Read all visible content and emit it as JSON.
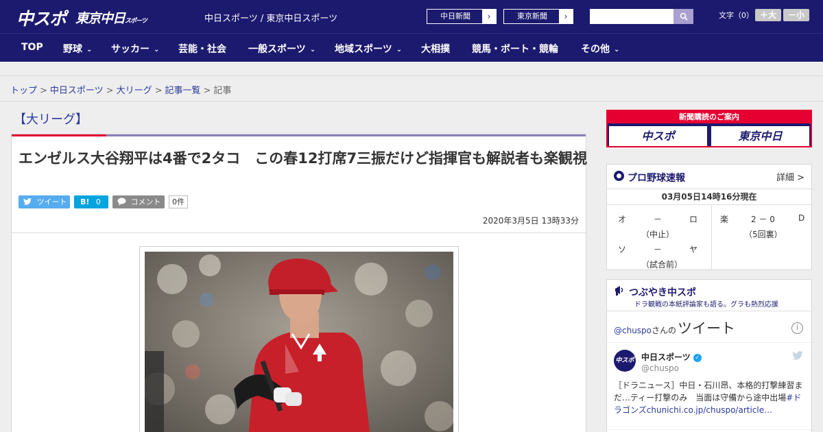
{
  "header": {
    "logo_primary": "中スポ",
    "logo_secondary": "東京中日",
    "logo_secondary_small": "スポーツ",
    "site_links": "中日スポーツ / 東京中日スポーツ",
    "paper_links": [
      {
        "label": "中日新聞",
        "arrow": "›"
      },
      {
        "label": "東京新聞",
        "arrow": "›"
      }
    ],
    "search_icon": "search-icon",
    "font_label": "文字（0）",
    "font_larger": "＋大",
    "font_smaller": "－小"
  },
  "nav": {
    "items": [
      {
        "label": "TOP",
        "dropdown": false
      },
      {
        "label": "野球",
        "dropdown": true
      },
      {
        "label": "サッカー",
        "dropdown": true
      },
      {
        "label": "芸能・社会",
        "dropdown": false
      },
      {
        "label": "一般スポーツ",
        "dropdown": true
      },
      {
        "label": "地域スポーツ",
        "dropdown": true
      },
      {
        "label": "大相撲",
        "dropdown": false
      },
      {
        "label": "競馬・ボート・競輪",
        "dropdown": false
      },
      {
        "label": "その他",
        "dropdown": true
      }
    ],
    "chevron": "⌄"
  },
  "breadcrumb": {
    "items": [
      "トップ",
      "中日スポーツ",
      "大リーグ",
      "記事一覧"
    ],
    "current": "記事",
    "separator": ">"
  },
  "article": {
    "category": "【大リーグ】",
    "title": "エンゼルス大谷翔平は4番で2タコ　この春12打席7三振だけど指揮官も解説者も楽観視",
    "share": {
      "tweet": "ツイート",
      "hatena_label": "B!",
      "hatena_count": "0",
      "comment": "コメント",
      "comment_count": "0件"
    },
    "date": "2020年3月5日 13時33分"
  },
  "sidebar": {
    "ad": {
      "banner": "新聞購読のご案内",
      "box1": "中スポ",
      "box2": "東京中日"
    },
    "scores": {
      "title": "プロ野球速報",
      "detail": "詳細 >",
      "as_of": "03月05日14時16分現在",
      "games": [
        {
          "home": "オ",
          "score": "－",
          "away": "ロ",
          "status": "（中止）"
        },
        {
          "home": "楽",
          "score": "2 － 0",
          "away": "D",
          "status": "（5回裏）"
        },
        {
          "home": "ソ",
          "score": "－",
          "away": "ヤ",
          "status": "（試合前）"
        }
      ]
    },
    "tweets": {
      "title": "つぶやき中スポ",
      "subtitle": "ドラ観戦の本紙評論家も語る。グラも熱烈応援",
      "handle_prefix": "@chuspo",
      "handle_suffix": "さんの",
      "heading": "ツイート",
      "info": "i",
      "account_name": "中日スポーツ",
      "account_handle": "@chuspo",
      "avatar_text": "中スポ",
      "verified": "✓",
      "text_plain": "［ドラニュース］中日・石川昂、本格的打撃練習まだ…ティー打撃のみ　当面は守備から途中出場",
      "text_link": "#ドラゴンズchunichi.co.jp/chuspo/article…"
    }
  }
}
